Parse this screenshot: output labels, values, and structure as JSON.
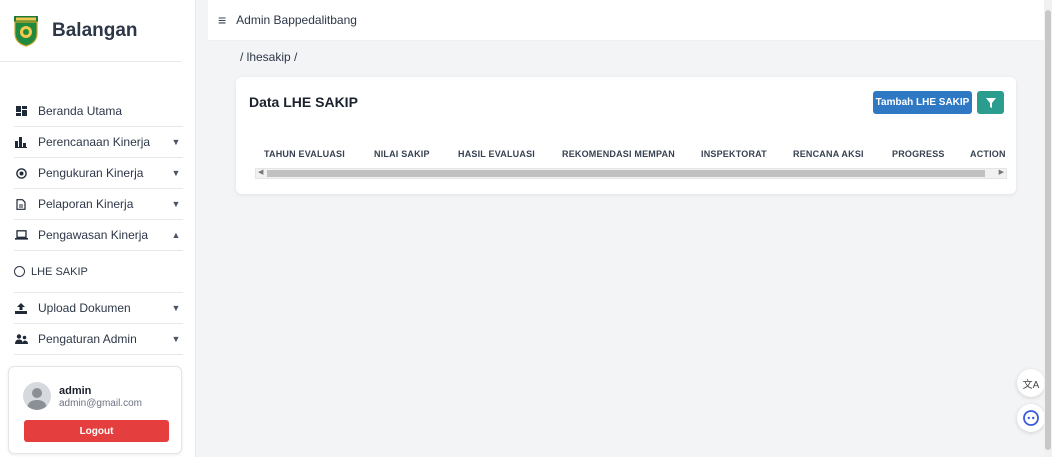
{
  "sidebar": {
    "brand": "Balangan",
    "items": [
      {
        "label": "Beranda Utama",
        "icon": "dashboard-icon",
        "expandable": false
      },
      {
        "label": "Perencanaan Kinerja",
        "icon": "chart-icon",
        "expandable": true,
        "chevron": "▼"
      },
      {
        "label": "Pengukuran Kinerja",
        "icon": "target-icon",
        "expandable": true,
        "chevron": "▼"
      },
      {
        "label": "Pelaporan Kinerja",
        "icon": "document-icon",
        "expandable": true,
        "chevron": "▼"
      },
      {
        "label": "Pengawasan Kinerja",
        "icon": "laptop-icon",
        "expandable": true,
        "chevron": "▲"
      },
      {
        "label": "Upload Dokumen",
        "icon": "upload-icon",
        "expandable": true,
        "chevron": "▼"
      },
      {
        "label": "Pengaturan Admin",
        "icon": "users-icon",
        "expandable": true,
        "chevron": "▼"
      }
    ],
    "sub_item": {
      "label": "LHE SAKIP"
    },
    "user": {
      "name": "admin",
      "email": "admin@gmail.com",
      "logout_label": "Logout"
    }
  },
  "topbar": {
    "title": "Admin Bappedalitbang"
  },
  "breadcrumb": "/ lhesakip /",
  "card": {
    "title": "Data LHE SAKIP",
    "add_label": "Tambah LHE SAKIP",
    "columns": [
      "TAHUN EVALUASI",
      "NILAI SAKIP",
      "HASIL EVALUASI",
      "REKOMENDASI MEMPAN",
      "INSPEKTORAT",
      "RENCANA AKSI",
      "PROGRESS",
      "ACTION"
    ]
  },
  "floating": {
    "translate_label": "文A"
  },
  "colors": {
    "logout": "#e53e3e",
    "primary": "#2f78c4",
    "filter": "#2a9d8f"
  }
}
